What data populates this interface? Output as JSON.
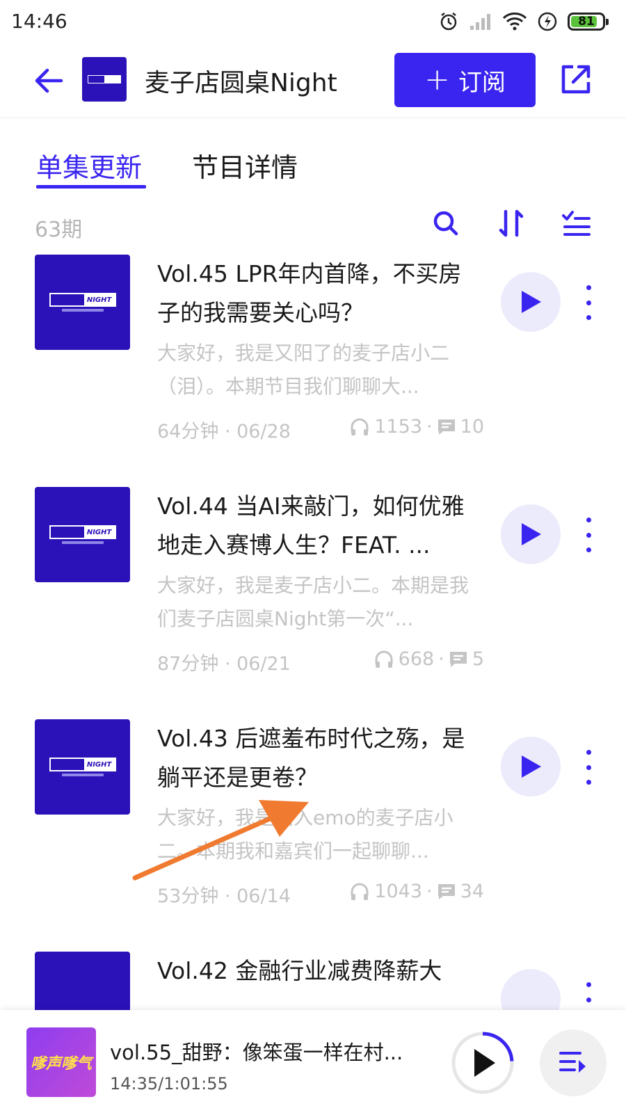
{
  "status_bar": {
    "time": "14:46",
    "battery": "81"
  },
  "header": {
    "title": "麦子店圆桌Night",
    "subscribe_label": "订阅"
  },
  "tabs": [
    {
      "label": "单集更新"
    },
    {
      "label": "节目详情"
    }
  ],
  "episode_count": "63期",
  "episodes": [
    {
      "title": "Vol.45 LPR年内首降，不买房子的我需要关心吗？",
      "description": "大家好，我是又阳了的麦子店小二（泪）。本期节目我们聊聊大...",
      "duration_date": "64分钟 · 06/28",
      "plays": "1153",
      "comments": "10"
    },
    {
      "title": "Vol.44 当AI来敲门，如何优雅地走入赛博人生？FEAT. ...",
      "description": "大家好，我是麦子店小二。本期是我们麦子店圆桌Night第一次“...",
      "duration_date": "87分钟 · 06/21",
      "plays": "668",
      "comments": "5"
    },
    {
      "title": "Vol.43 后遮羞布时代之殇，是躺平还是更卷？",
      "description": "大家好，我是陷入emo的麦子店小二。本期我和嘉宾们一起聊聊...",
      "duration_date": "53分钟 · 06/14",
      "plays": "1043",
      "comments": "34"
    },
    {
      "title": "Vol.42 金融行业减费降薪大"
    }
  ],
  "mini_player": {
    "title": "vol.55_甜野：像笨蛋一样在村...",
    "time": "14:35/1:01:55",
    "cover_text": "嗲声嗲气",
    "progress": 0.24
  },
  "colors": {
    "accent": "#3a24f0",
    "cover_bg": "#2a11b8",
    "annotation_arrow": "#f07a2f"
  }
}
